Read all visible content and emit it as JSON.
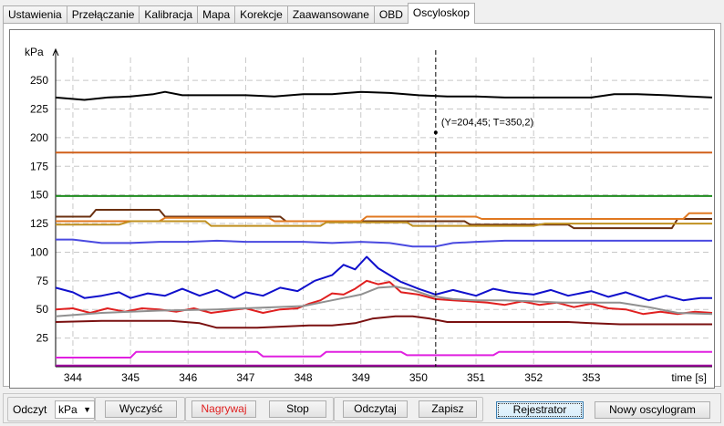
{
  "tabs": [
    "Ustawienia",
    "Przełączanie",
    "Kalibracja",
    "Mapa",
    "Korekcje",
    "Zaawansowane",
    "OBD",
    "Oscyloskop"
  ],
  "active_tab": "Oscyloskop",
  "toolbar": {
    "unit_label": "Odczyt",
    "unit_value": "kPa",
    "clear_label": "Wyczyść",
    "record_label": "Nagrywaj",
    "stop_label": "Stop",
    "read_label": "Odczytaj",
    "save_label": "Zapisz",
    "recorder_label": "Rejestrator",
    "new_osc_label": "Nowy oscylogram"
  },
  "colors": {
    "accent_record": "#e02020",
    "grid": "#c8c8c8"
  },
  "chart_data": {
    "type": "line",
    "ylabel": "kPa",
    "xlabel": "time [s]",
    "xlim": [
      343.7,
      355.1
    ],
    "ylim": [
      0,
      270
    ],
    "yticks": [
      25,
      50,
      75,
      100,
      125,
      150,
      175,
      200,
      225,
      250
    ],
    "xticks": [
      344,
      345,
      346,
      347,
      348,
      349,
      350,
      351,
      352,
      353
    ],
    "grid": true,
    "cursor": {
      "t": 350.3,
      "label": "(Y=204,45; T=350,2)",
      "y": 204.45
    },
    "series": [
      {
        "color": "#000000",
        "x": [
          343.7,
          344.2,
          344.6,
          345.0,
          345.4,
          345.6,
          345.9,
          346.5,
          347.0,
          347.5,
          348.0,
          348.5,
          349.0,
          349.5,
          350.0,
          350.5,
          351.0,
          351.5,
          352.0,
          352.5,
          353.0,
          353.4,
          353.8,
          354.3,
          354.7,
          355.1
        ],
        "y": [
          235,
          233,
          235,
          236,
          238,
          240,
          237,
          237,
          237,
          236,
          238,
          238,
          240,
          239,
          237,
          236,
          236,
          235,
          235,
          235,
          235,
          238,
          238,
          237,
          236,
          235
        ]
      },
      {
        "color": "#d0601a",
        "x": [
          343.7,
          355.1
        ],
        "y": [
          187,
          187
        ]
      },
      {
        "color": "#1e8c1e",
        "x": [
          343.7,
          355.1
        ],
        "y": [
          149,
          149
        ]
      },
      {
        "color": "#6b3010",
        "x": [
          343.7,
          344.3,
          344.4,
          345.5,
          345.6,
          346.5,
          347.6,
          347.7,
          350.8,
          350.9,
          352.6,
          352.7,
          354.4,
          354.5,
          355.1
        ],
        "y": [
          131,
          131,
          137,
          137,
          131,
          131,
          131,
          127,
          127,
          124,
          124,
          121,
          121,
          129,
          129
        ]
      },
      {
        "color": "#e07820",
        "x": [
          343.7,
          345.5,
          345.6,
          347.4,
          347.5,
          349.0,
          349.1,
          351.0,
          351.1,
          354.6,
          354.7,
          355.1
        ],
        "y": [
          127,
          127,
          130,
          130,
          127,
          127,
          131,
          131,
          129,
          129,
          134,
          134
        ]
      },
      {
        "color": "#c09020",
        "x": [
          343.7,
          344.8,
          345.0,
          346.3,
          346.4,
          348.3,
          348.4,
          349.8,
          349.9,
          352.0,
          352.2,
          354.8,
          355.1
        ],
        "y": [
          124,
          124,
          127,
          127,
          123,
          123,
          126,
          126,
          123,
          123,
          125,
          125,
          125
        ]
      },
      {
        "color": "#4a4ae0",
        "x": [
          343.7,
          344.0,
          344.5,
          345.0,
          345.5,
          346.0,
          346.5,
          347.0,
          347.5,
          348.0,
          348.5,
          349.0,
          349.5,
          349.9,
          350.3,
          350.6,
          351.0,
          351.5,
          352.0,
          352.5,
          353.0,
          353.5,
          354.0,
          354.5,
          355.1
        ],
        "y": [
          111,
          111,
          108,
          108,
          109,
          109,
          110,
          109,
          109,
          109,
          108,
          109,
          108,
          105,
          105,
          108,
          109,
          110,
          110,
          110,
          110,
          110,
          110,
          110,
          110
        ]
      },
      {
        "color": "#1010cc",
        "x": [
          343.7,
          344.0,
          344.2,
          344.5,
          344.8,
          345.0,
          345.3,
          345.6,
          345.9,
          346.2,
          346.5,
          346.8,
          347.0,
          347.3,
          347.6,
          347.9,
          348.2,
          348.5,
          348.7,
          348.9,
          349.1,
          349.3,
          349.5,
          349.7,
          350.0,
          350.3,
          350.6,
          351.0,
          351.3,
          351.6,
          352.0,
          352.3,
          352.6,
          353.0,
          353.3,
          353.6,
          354.0,
          354.3,
          354.6,
          354.9,
          355.1
        ],
        "y": [
          69,
          65,
          60,
          62,
          65,
          60,
          64,
          62,
          68,
          62,
          67,
          60,
          65,
          62,
          69,
          66,
          75,
          80,
          89,
          85,
          96,
          86,
          80,
          74,
          68,
          63,
          67,
          62,
          68,
          65,
          63,
          67,
          62,
          66,
          61,
          65,
          58,
          62,
          58,
          60,
          60
        ]
      },
      {
        "color": "#e02020",
        "x": [
          343.7,
          344.0,
          344.3,
          344.6,
          344.9,
          345.2,
          345.5,
          345.8,
          346.1,
          346.4,
          346.7,
          347.0,
          347.3,
          347.6,
          347.9,
          348.1,
          348.3,
          348.5,
          348.7,
          348.9,
          349.1,
          349.3,
          349.5,
          349.7,
          350.0,
          350.3,
          350.6,
          350.9,
          351.2,
          351.5,
          351.8,
          352.1,
          352.4,
          352.7,
          353.0,
          353.3,
          353.6,
          353.9,
          354.2,
          354.5,
          354.8,
          355.1
        ],
        "y": [
          50,
          51,
          47,
          51,
          48,
          51,
          50,
          48,
          51,
          47,
          49,
          51,
          47,
          50,
          51,
          55,
          58,
          64,
          63,
          68,
          75,
          72,
          74,
          65,
          63,
          59,
          58,
          57,
          56,
          54,
          57,
          54,
          56,
          52,
          55,
          51,
          50,
          46,
          48,
          46,
          48,
          47
        ]
      },
      {
        "color": "#909090",
        "x": [
          343.7,
          344.5,
          345.5,
          346.5,
          347.5,
          348.0,
          348.5,
          349.0,
          349.3,
          349.6,
          349.9,
          350.2,
          350.6,
          351.0,
          351.5,
          352.0,
          352.5,
          353.0,
          353.5,
          354.0,
          354.5,
          355.1
        ],
        "y": [
          44,
          47,
          49,
          50,
          52,
          53,
          58,
          63,
          69,
          70,
          67,
          62,
          59,
          58,
          58,
          57,
          56,
          56,
          56,
          52,
          47,
          46
        ]
      },
      {
        "color": "#7a1010",
        "x": [
          343.7,
          344.5,
          345.3,
          345.7,
          346.2,
          346.5,
          347.2,
          347.6,
          348.1,
          348.5,
          348.9,
          349.2,
          349.6,
          349.9,
          350.2,
          350.5,
          351.0,
          352.0,
          352.6,
          353.0,
          353.5,
          354.0,
          354.5,
          355.1
        ],
        "y": [
          39,
          40,
          40,
          40,
          38,
          34,
          34,
          35,
          36,
          36,
          38,
          42,
          44,
          44,
          42,
          39,
          39,
          39,
          39,
          38,
          37,
          37,
          37,
          37
        ]
      },
      {
        "color": "#e020e0",
        "x": [
          343.7,
          345.0,
          345.1,
          347.2,
          347.3,
          348.3,
          348.4,
          349.7,
          349.8,
          351.3,
          351.4,
          352.0,
          352.1,
          355.1
        ],
        "y": [
          8,
          8,
          13,
          13,
          9,
          9,
          13,
          13,
          10,
          10,
          13,
          13,
          13,
          13
        ]
      },
      {
        "color": "#a000a0",
        "x": [
          343.7,
          355.1
        ],
        "y": [
          1,
          1
        ]
      }
    ]
  }
}
